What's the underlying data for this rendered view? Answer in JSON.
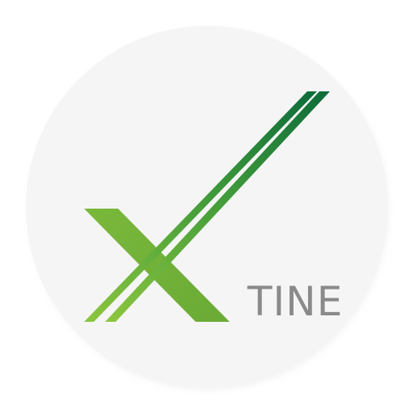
{
  "app_icon": {
    "wordmark": "TINE",
    "icon_name": "xtine-x-logo-icon",
    "colors": {
      "badge_background": "#f5f5f5",
      "badge_shadow": "#d6d6d6",
      "green_dark": "#0d6b3a",
      "green_mid": "#3f9a3a",
      "green_light": "#7ab83b",
      "wordmark_text": "#8a8a8a"
    }
  }
}
